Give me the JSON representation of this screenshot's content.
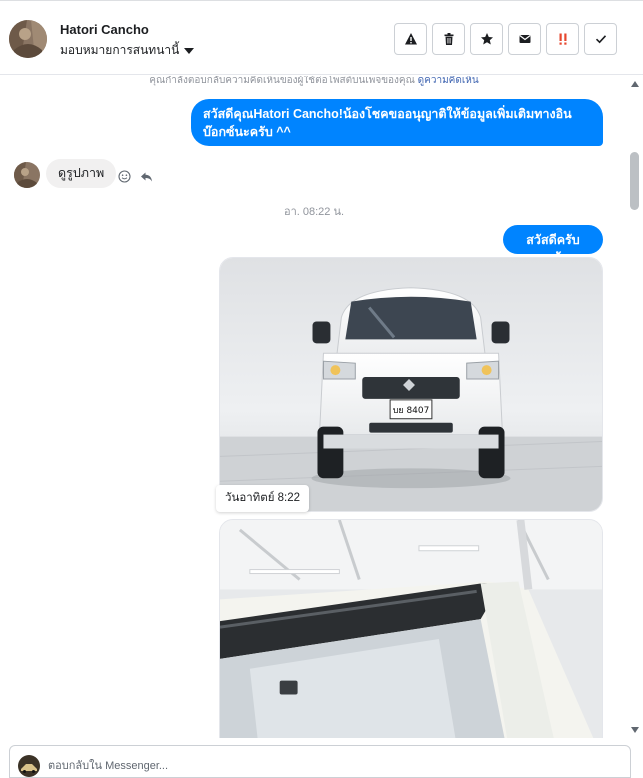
{
  "header": {
    "contact_name": "Hatori Cancho",
    "assign_label": "มอบหมายการสนทนานี้",
    "actions": [
      {
        "name": "mark-spam-button",
        "icon": "warning-icon"
      },
      {
        "name": "delete-button",
        "icon": "trash-icon"
      },
      {
        "name": "star-button",
        "icon": "star-icon"
      },
      {
        "name": "mark-unread-button",
        "icon": "envelope-icon"
      },
      {
        "name": "follow-up-button",
        "icon": "exclamation-icon"
      },
      {
        "name": "mark-done-button",
        "icon": "check-icon"
      }
    ]
  },
  "chat": {
    "notice_text": "คุณกำลังตอบกลับความคิดเห็นของผู้ใช้ต่อโพสต์บนเพจของคุณ",
    "notice_link": "ดูความคิดเห็น",
    "greeting_message": "สวัสดีคุณHatori Cancho!น้องโชคขออนุญาติให้ข้อมูลเพิ่มเติมทางอินบ๊อกซ์นะครับ ^^",
    "incoming_message": "ดูรูปภาพ",
    "timestamp": "อา. 08:22 น.",
    "reply_message": "สวัสดีครับลูกค้า",
    "photo_time_tag": "วันอาทิตย์ 8:22",
    "plate_text": "บย 8407"
  },
  "composer": {
    "placeholder": "ตอบกลับใน Messenger..."
  },
  "colors": {
    "messenger_blue": "#0084ff",
    "incoming_bubble": "#f1f0f0",
    "border": "#ccd0d5"
  }
}
